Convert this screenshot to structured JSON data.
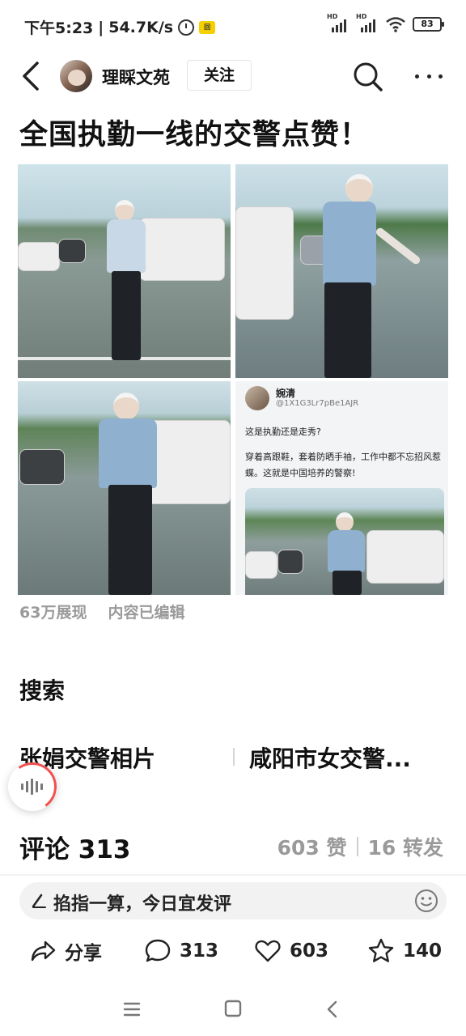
{
  "status_bar": {
    "time": "下午5:23",
    "speed": "54.7K/s",
    "network_1": "HD",
    "network_2": "HD",
    "battery": "83"
  },
  "header": {
    "author": "理睬文苑",
    "follow_label": "关注"
  },
  "post": {
    "title": "全国执勤一线的交警点赞！",
    "embedded_tweet": {
      "name": "婉清",
      "handle": "@1X1G3Lr7pBe1AJR",
      "line1": "这是执勤还是走秀?",
      "line2": "穿着高跟鞋，套着防晒手袖，工作中都不忘招风惹蝶。这就是中国培养的警察!"
    },
    "views": "63万展现",
    "edited": "内容已编辑"
  },
  "search": {
    "heading": "搜索",
    "suggestions": [
      "张娟交警相片",
      "咸阳市女交警..."
    ]
  },
  "comments": {
    "title": "评论 313",
    "likes": "603 赞",
    "shares": "16 转发",
    "input_placeholder": "掐指一算，今日宜发评"
  },
  "actions": {
    "share": "分享",
    "comment_count": "313",
    "like_count": "603",
    "favorite_count": "140"
  },
  "colors": {
    "accent_red": "#f05050",
    "muted_text": "#9a9a9a"
  }
}
